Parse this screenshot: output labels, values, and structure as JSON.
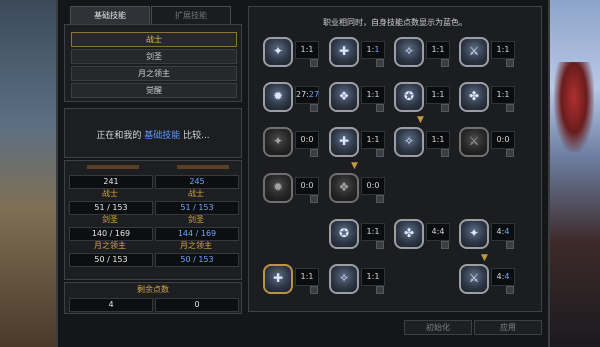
{
  "tabs": {
    "basic": "基础技能",
    "extended": "扩展技能"
  },
  "classes": [
    "战士",
    "剑圣",
    "月之领主",
    "觉醒"
  ],
  "compare": {
    "prefix": "正在和我的 ",
    "highlight": "基础技能",
    "suffix": " 比较..."
  },
  "stats": {
    "total_left": "241",
    "total_right": "245",
    "rows": [
      {
        "name": "战士",
        "left": "51 / 153",
        "right": "51 / 153"
      },
      {
        "name": "剑圣",
        "left": "140 / 169",
        "right": "144 / 169"
      },
      {
        "name": "月之领主",
        "left": "50 / 153",
        "right": "50 / 153"
      }
    ],
    "remaining_label": "剩余点数",
    "remaining_left": "4",
    "remaining_right": "0"
  },
  "info_text": "职业相同时，自身技能点数显示为蓝色。",
  "skills": [
    {
      "a": "1",
      "b": "1",
      "blue": false
    },
    {
      "a": "1",
      "b": "1",
      "blue": true
    },
    {
      "a": "1",
      "b": "1",
      "blue": false
    },
    {
      "a": "1",
      "b": "1",
      "blue": false
    },
    {
      "a": "27",
      "b": "27",
      "blue": true
    },
    {
      "a": "1",
      "b": "1",
      "blue": false
    },
    {
      "a": "1",
      "b": "1",
      "blue": false
    },
    {
      "a": "1",
      "b": "1",
      "blue": false
    },
    {
      "a": "0",
      "b": "0",
      "blue": false
    },
    {
      "a": "1",
      "b": "1",
      "blue": false
    },
    {
      "a": "1",
      "b": "1",
      "blue": false
    },
    {
      "a": "0",
      "b": "0",
      "blue": false
    },
    {
      "a": "0",
      "b": "0",
      "blue": false
    },
    {
      "a": "0",
      "b": "0",
      "blue": false
    },
    {
      "a": "1",
      "b": "1",
      "blue": false
    },
    {
      "a": "4",
      "b": "4",
      "blue": false
    },
    {
      "a": "4",
      "b": "4",
      "blue": true
    },
    {
      "a": "1",
      "b": "1",
      "blue": false
    },
    {
      "a": "1",
      "b": "1",
      "blue": false
    },
    {
      "a": "4",
      "b": "4",
      "blue": true
    }
  ],
  "buttons": {
    "init": "初始化",
    "apply": "应用"
  }
}
